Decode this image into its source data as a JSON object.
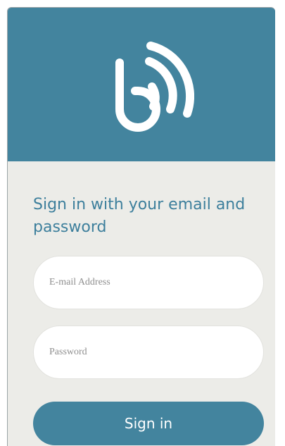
{
  "header": {
    "logo_icon": "b-signal-logo-icon",
    "background_color": "#43849e"
  },
  "signin": {
    "heading": "Sign in with your email and password",
    "email": {
      "value": "",
      "placeholder": "E-mail Address"
    },
    "password": {
      "value": "",
      "placeholder": "Password"
    },
    "button_label": "Sign in"
  },
  "colors": {
    "accent": "#43849e",
    "heading_text": "#3d7f9c",
    "background": "#ecece8",
    "field_background": "#ffffff"
  }
}
